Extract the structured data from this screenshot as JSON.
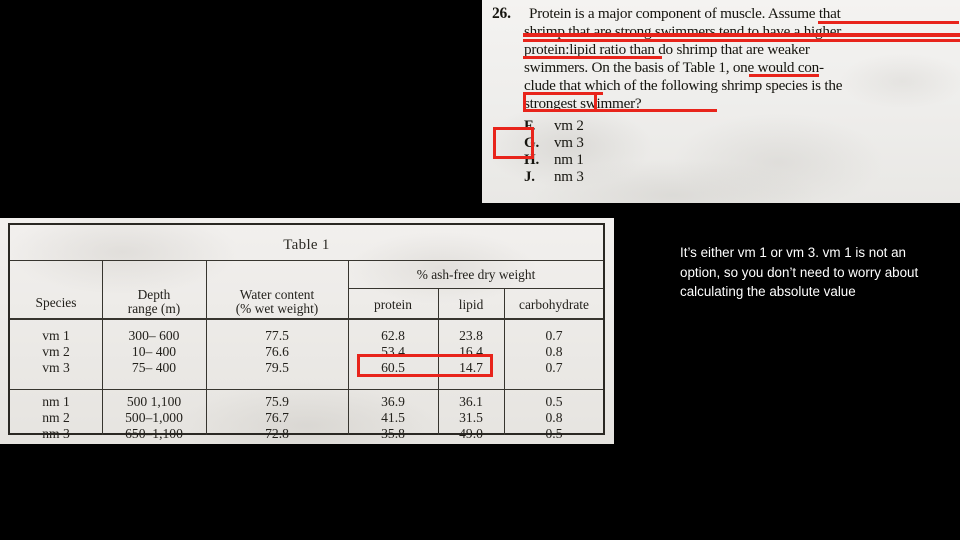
{
  "slide": {
    "background_color": "#000000",
    "note_text_color": "#ffffff",
    "marker_color": "#e8241b",
    "paper_color": "#f1f0ee"
  },
  "question": {
    "number": "26.",
    "lines": [
      "Protein is a major component of muscle. Assume that",
      "shrimp that are strong swimmers tend to have a higher",
      "protein:lipid ratio than do shrimp that are weaker",
      "swimmers. On the basis of Table 1, one would con-",
      "clude that which of the following shrimp species is the",
      "strongest swimmer?"
    ],
    "choices": [
      {
        "letter": "F.",
        "value": "vm 2"
      },
      {
        "letter": "G.",
        "value": "vm 3"
      },
      {
        "letter": "H.",
        "value": "nm 1"
      },
      {
        "letter": "J.",
        "value": "nm 3"
      }
    ],
    "marked_choice_letter": "G."
  },
  "table": {
    "caption": "Table 1",
    "group_header": "% ash-free dry weight",
    "columns": [
      "Species",
      "Depth range (m)",
      "Water content (% wet weight)",
      "protein",
      "lipid",
      "carbohydrate"
    ],
    "column_lines": {
      "species": [
        "Species"
      ],
      "depth": [
        "Depth",
        "range (m)"
      ],
      "water": [
        "Water content",
        "(% wet weight)"
      ],
      "protein": [
        "protein"
      ],
      "lipid": [
        "lipid"
      ],
      "carbohydrate": [
        "carbohydrate"
      ]
    },
    "rows": [
      {
        "species": "vm 1",
        "depth": "300–  600",
        "water": "77.5",
        "protein": "62.8",
        "lipid": "23.8",
        "carbohydrate": "0.7"
      },
      {
        "species": "vm 2",
        "depth": "10–  400",
        "water": "76.6",
        "protein": "53.4",
        "lipid": "16.4",
        "carbohydrate": "0.8"
      },
      {
        "species": "vm 3",
        "depth": "75–  400",
        "water": "79.5",
        "protein": "60.5",
        "lipid": "14.7",
        "carbohydrate": "0.7"
      },
      {
        "species": "nm 1",
        "depth": "500  1,100",
        "water": "75.9",
        "protein": "36.9",
        "lipid": "36.1",
        "carbohydrate": "0.5"
      },
      {
        "species": "nm 2",
        "depth": "500–1,000",
        "water": "76.7",
        "protein": "41.5",
        "lipid": "31.5",
        "carbohydrate": "0.8"
      },
      {
        "species": "nm 3",
        "depth": "650–1,100",
        "water": "72.8",
        "protein": "35.8",
        "lipid": "49.0",
        "carbohydrate": "0.5"
      }
    ],
    "highlighted_row_species": "vm 3",
    "highlighted_values": [
      "60.5",
      "14.7"
    ]
  },
  "note": {
    "text": "It’s either vm 1 or vm 3. vm 1 is not an option, so you don’t need to worry about calculating the absolute value"
  }
}
